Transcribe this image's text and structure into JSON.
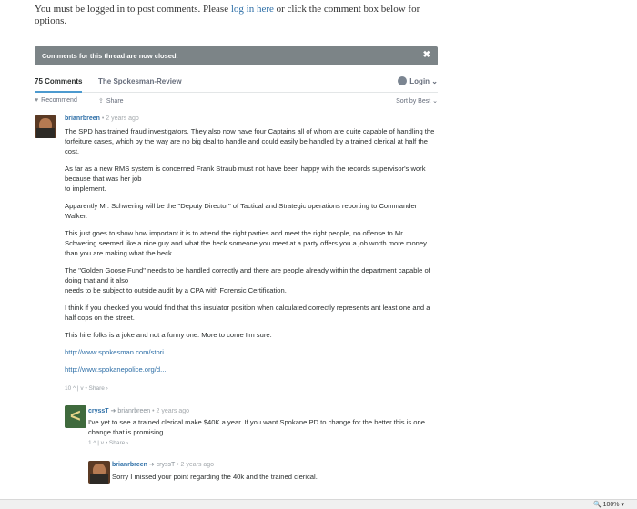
{
  "login_note": {
    "prefix": "You must be logged in to post comments. Please ",
    "link": "log in here",
    "suffix": " or click the comment box below for options."
  },
  "closed_notice": {
    "text": "Comments for this thread are now closed.",
    "close": "✖"
  },
  "nav": {
    "comments_tab": "75 Comments",
    "forum_tab": "The Spokesman-Review",
    "login": "Login",
    "login_chevron": "⌄"
  },
  "toolbar": {
    "recommend": "Recommend",
    "recommend_icon": "♥",
    "share": "Share",
    "share_icon": "⇪",
    "sort": "Sort by Best ⌄"
  },
  "comments": [
    {
      "author": "brianrbreen",
      "reply_to": "",
      "time": " • 2 years ago",
      "paragraphs": [
        "The SPD has trained fraud investigators. They also now have four Captains all of whom are quite capable of handling the forfeiture cases, which by the way are no big deal to handle and could easily be handled by a trained clerical at half the cost.",
        "As far as a new RMS system is concerned Frank Straub must not have been happy with the records supervisor's work because that was her job\nto implement.",
        "Apparently Mr. Schwering will be the \"Deputy Director\" of Tactical and Strategic operations reporting to Commander Walker.",
        "This just goes to show how important it is to attend the right parties and meet the right people, no offense to Mr. Schwering seemed like a nice guy and what the heck someone you meet at a party offers you a job worth more money than you are making what the heck.",
        "The \"Golden Goose Fund\" needs to be handled correctly and there are people already within the department capable of doing that and it also\nneeds to be subject to outside audit by a CPA with Forensic Certification.",
        "I think if you checked you would find that this insulator position when calculated correctly represents ant least one and a half cops on the street.",
        "This hire folks is a joke and not a funny one. More to come I'm sure."
      ],
      "links": [
        "http://www.spokesman.com/stori...",
        "http://www.spokanepolice.org/d..."
      ],
      "actions": "10 ^  |  v  • Share ›"
    },
    {
      "author": "cryssT",
      "reply_to": " ➜ brianrbreen",
      "time": " • 2 years ago",
      "paragraphs": [
        "I've yet to see a trained clerical make $40K a year. If you want Spokane PD to change for the better this is one change that is promising."
      ],
      "links": [],
      "actions": "1 ^  |  v  • Share ›"
    },
    {
      "author": "brianrbreen",
      "reply_to": " ➜ cryssT",
      "time": " • 2 years ago",
      "paragraphs": [
        "Sorry I missed your point regarding the 40k and the trained clerical."
      ],
      "links": [],
      "actions": ""
    }
  ],
  "statusbar": {
    "zoom": "🔍 100%  ▾"
  }
}
